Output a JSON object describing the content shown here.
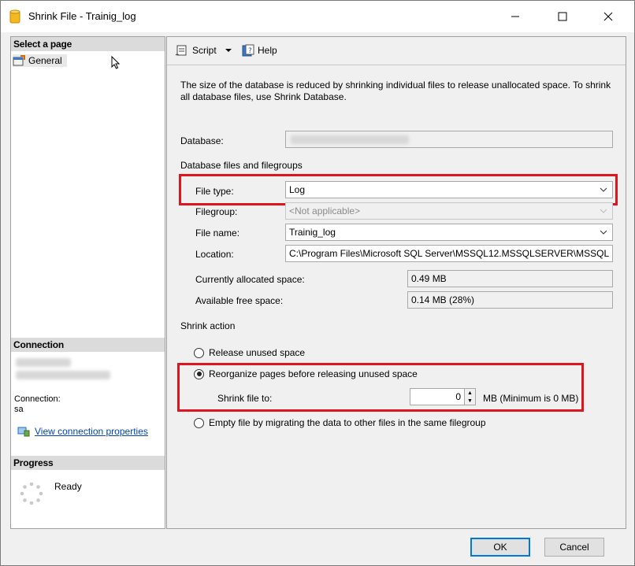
{
  "window": {
    "title": "Shrink File - Trainig_log"
  },
  "left": {
    "select_page": "Select a page",
    "general": "General",
    "connection_header": "Connection",
    "connection_label": "Connection:",
    "connection_value": "sa",
    "view_connection": "View connection properties",
    "progress_header": "Progress",
    "progress_status": "Ready"
  },
  "toolbar": {
    "script": "Script",
    "help": "Help"
  },
  "main": {
    "description": "The size of the database is reduced by shrinking individual files to release unallocated space. To shrink all database files, use Shrink Database.",
    "database_label": "Database:",
    "files_group": "Database files and filegroups",
    "file_type_label": "File type:",
    "file_type_value": "Log",
    "filegroup_label": "Filegroup:",
    "filegroup_value": "<Not applicable>",
    "file_name_label": "File name:",
    "file_name_value": "Trainig_log",
    "location_label": "Location:",
    "location_value": "C:\\Program Files\\Microsoft SQL Server\\MSSQL12.MSSQLSERVER\\MSSQL",
    "allocated_label": "Currently allocated space:",
    "allocated_value": "0.49 MB",
    "free_label": "Available free space:",
    "free_value": "0.14 MB (28%)",
    "shrink_action": "Shrink action",
    "opt_release": "Release unused space",
    "opt_reorganize": "Reorganize pages before releasing unused space",
    "shrink_to_label": "Shrink file to:",
    "shrink_to_value": "0",
    "shrink_to_unit": "MB (Minimum is 0 MB)",
    "opt_empty": "Empty file by migrating the data to other files in the same filegroup"
  },
  "footer": {
    "ok": "OK",
    "cancel": "Cancel"
  },
  "colors": {
    "highlight": "#e0141e",
    "link": "#0645ad",
    "folder": "#f5b820"
  }
}
